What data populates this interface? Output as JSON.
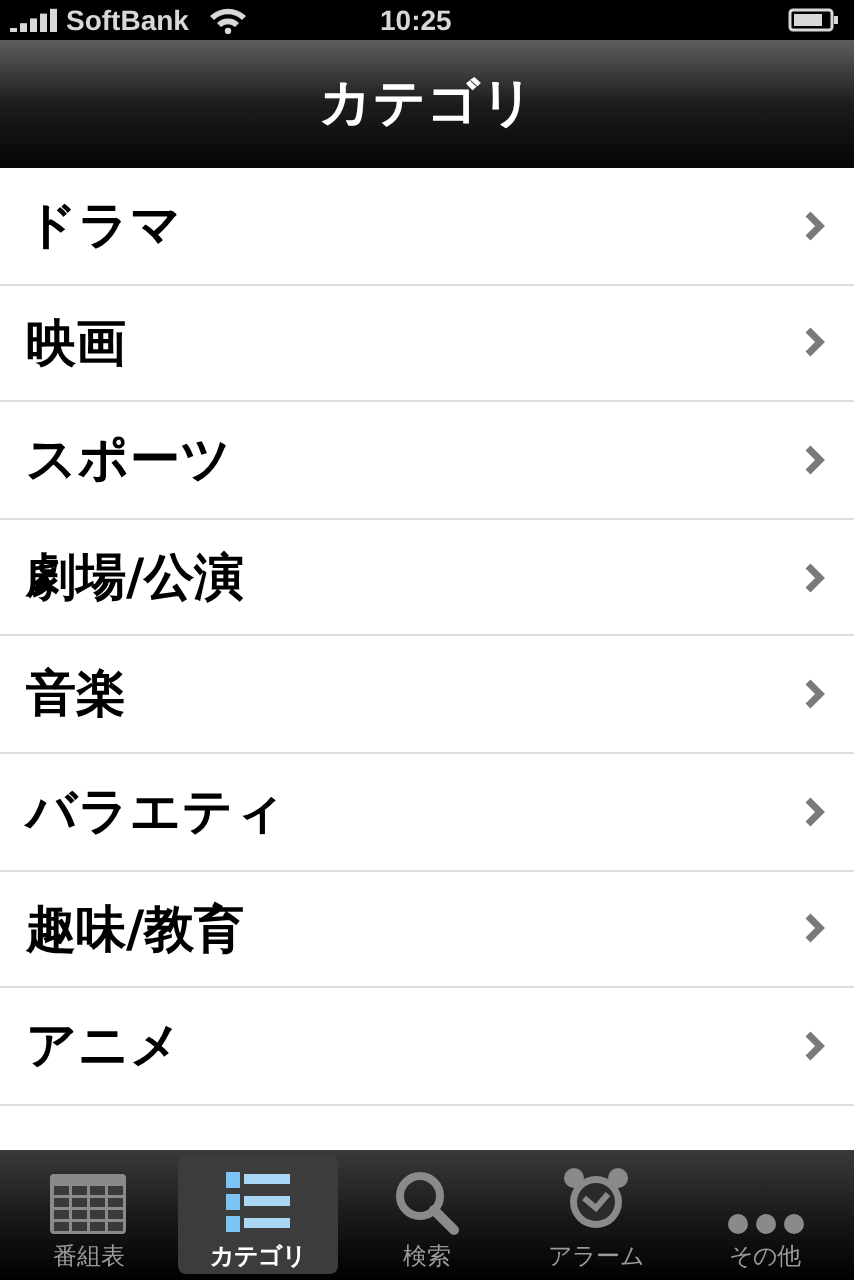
{
  "status_bar": {
    "carrier": "SoftBank",
    "time": "10:25"
  },
  "nav_bar": {
    "title": "カテゴリ"
  },
  "categories": [
    {
      "label": "ドラマ"
    },
    {
      "label": "映画"
    },
    {
      "label": "スポーツ"
    },
    {
      "label": "劇場/公演"
    },
    {
      "label": "音楽"
    },
    {
      "label": "バラエティ"
    },
    {
      "label": "趣味/教育"
    },
    {
      "label": "アニメ"
    }
  ],
  "tab_bar": [
    {
      "label": "番組表",
      "kind": "grid",
      "selected": false
    },
    {
      "label": "カテゴリ",
      "kind": "list",
      "selected": true
    },
    {
      "label": "検索",
      "kind": "search",
      "selected": false
    },
    {
      "label": "アラーム",
      "kind": "alarm",
      "selected": false
    },
    {
      "label": "その他",
      "kind": "more",
      "selected": false
    }
  ]
}
